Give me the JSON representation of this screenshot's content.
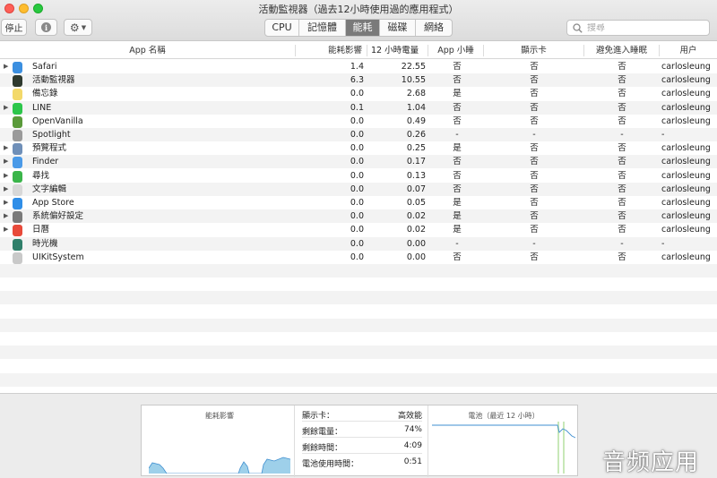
{
  "window": {
    "title": "活動監視器（過去12小時使用過的應用程式）"
  },
  "toolbar": {
    "stop_label": "停止",
    "info_icon": "info-icon",
    "gear_icon": "gear-icon",
    "tabs": [
      {
        "label": "CPU",
        "active": false
      },
      {
        "label": "記憶體",
        "active": false
      },
      {
        "label": "能耗",
        "active": true
      },
      {
        "label": "磁碟",
        "active": false
      },
      {
        "label": "網絡",
        "active": false
      }
    ],
    "search_placeholder": "搜尋"
  },
  "table": {
    "columns": {
      "app_name": "App 名稱",
      "energy_impact": "能耗影響",
      "power_12h": "12 小時電量",
      "app_nap": "App 小睡",
      "gpu": "顯示卡",
      "prevent_sleep": "避免進入睡眠",
      "user": "用户"
    },
    "rows": [
      {
        "name": "Safari",
        "icon": "safari-icon",
        "color": "#3b8fe0",
        "expand": true,
        "impact": "1.4",
        "h12": "22.55",
        "nap": "否",
        "gpu": "否",
        "sleep": "否",
        "user": "carlosleung"
      },
      {
        "name": "活動監視器",
        "icon": "activity-monitor-icon",
        "color": "#2f3a2f",
        "expand": false,
        "impact": "6.3",
        "h12": "10.55",
        "nap": "否",
        "gpu": "否",
        "sleep": "否",
        "user": "carlosleung"
      },
      {
        "name": "備忘錄",
        "icon": "notes-icon",
        "color": "#f3d96a",
        "expand": false,
        "impact": "0.0",
        "h12": "2.68",
        "nap": "是",
        "gpu": "否",
        "sleep": "否",
        "user": "carlosleung"
      },
      {
        "name": "LINE",
        "icon": "line-icon",
        "color": "#2cc64a",
        "expand": true,
        "impact": "0.1",
        "h12": "1.04",
        "nap": "否",
        "gpu": "否",
        "sleep": "否",
        "user": "carlosleung"
      },
      {
        "name": "OpenVanilla",
        "icon": "openvanilla-icon",
        "color": "#5a9a3a",
        "expand": false,
        "impact": "0.0",
        "h12": "0.49",
        "nap": "否",
        "gpu": "否",
        "sleep": "否",
        "user": "carlosleung"
      },
      {
        "name": "Spotlight",
        "icon": "spotlight-icon",
        "color": "#9a9a9a",
        "expand": false,
        "impact": "0.0",
        "h12": "0.26",
        "nap": "-",
        "gpu": "-",
        "sleep": "-",
        "user": "-"
      },
      {
        "name": "預覽程式",
        "icon": "preview-icon",
        "color": "#6f8fb8",
        "expand": true,
        "impact": "0.0",
        "h12": "0.25",
        "nap": "是",
        "gpu": "否",
        "sleep": "否",
        "user": "carlosleung"
      },
      {
        "name": "Finder",
        "icon": "finder-icon",
        "color": "#4a9ae8",
        "expand": true,
        "impact": "0.0",
        "h12": "0.17",
        "nap": "否",
        "gpu": "否",
        "sleep": "否",
        "user": "carlosleung"
      },
      {
        "name": "尋找",
        "icon": "find-my-icon",
        "color": "#3bb54a",
        "expand": true,
        "impact": "0.0",
        "h12": "0.13",
        "nap": "否",
        "gpu": "否",
        "sleep": "否",
        "user": "carlosleung"
      },
      {
        "name": "文字編輯",
        "icon": "textedit-icon",
        "color": "#d8d8d8",
        "expand": true,
        "impact": "0.0",
        "h12": "0.07",
        "nap": "否",
        "gpu": "否",
        "sleep": "否",
        "user": "carlosleung"
      },
      {
        "name": "App Store",
        "icon": "app-store-icon",
        "color": "#2f8ee8",
        "expand": true,
        "impact": "0.0",
        "h12": "0.05",
        "nap": "是",
        "gpu": "否",
        "sleep": "否",
        "user": "carlosleung"
      },
      {
        "name": "系統偏好設定",
        "icon": "system-preferences-icon",
        "color": "#7a7a7a",
        "expand": true,
        "impact": "0.0",
        "h12": "0.02",
        "nap": "是",
        "gpu": "否",
        "sleep": "否",
        "user": "carlosleung"
      },
      {
        "name": "日曆",
        "icon": "calendar-icon",
        "color": "#e84a3a",
        "expand": true,
        "impact": "0.0",
        "h12": "0.02",
        "nap": "是",
        "gpu": "否",
        "sleep": "否",
        "user": "carlosleung"
      },
      {
        "name": "時光機",
        "icon": "time-machine-icon",
        "color": "#2f7f6a",
        "expand": false,
        "impact": "0.0",
        "h12": "0.00",
        "nap": "-",
        "gpu": "-",
        "sleep": "-",
        "user": "-"
      },
      {
        "name": "UIKitSystem",
        "icon": "uikitsystem-icon",
        "color": "#c9c9c9",
        "expand": false,
        "impact": "0.0",
        "h12": "0.00",
        "nap": "否",
        "gpu": "否",
        "sleep": "否",
        "user": "carlosleung"
      }
    ]
  },
  "summary": {
    "energy_graph_title": "能耗影響",
    "gpu_label": "顯示卡：",
    "gpu_value": "高效能",
    "battery_label": "剩餘電量：",
    "battery_value": "74%",
    "time_left_label": "剩餘時間：",
    "time_left_value": "4:09",
    "on_battery_label": "電池使用時間：",
    "on_battery_value": "0:51",
    "battery_graph_title": "電池（最近 12 小時）"
  },
  "watermark": "音频应用",
  "colors": {
    "accent_graph": "#9ed0ea",
    "graph_line": "#3f8fd0",
    "active_tab": "#7a7a7a"
  }
}
